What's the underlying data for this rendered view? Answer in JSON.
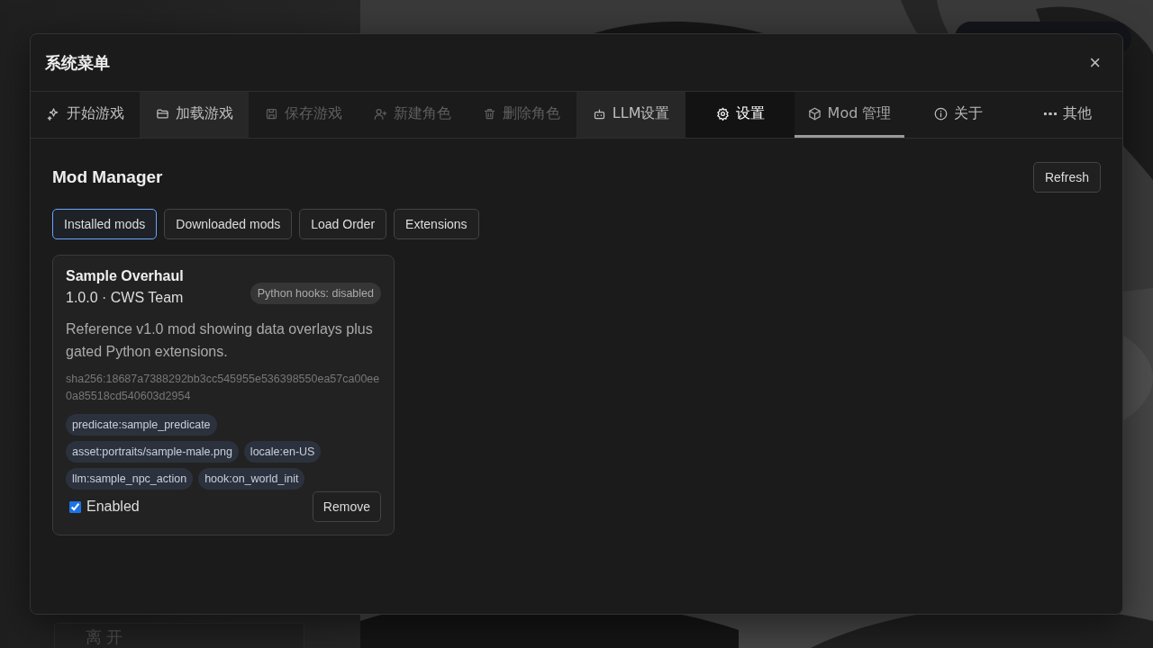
{
  "background": {
    "leave_button": "离 开"
  },
  "dialog": {
    "title": "系统菜单",
    "close": "×",
    "tabs": [
      {
        "label": "开始游戏",
        "disabled": false,
        "selected": false,
        "hovered": false,
        "focused": false
      },
      {
        "label": "加载游戏",
        "disabled": false,
        "selected": false,
        "hovered": true,
        "focused": false
      },
      {
        "label": "保存游戏",
        "disabled": true,
        "selected": false,
        "hovered": false,
        "focused": false
      },
      {
        "label": "新建角色",
        "disabled": true,
        "selected": false,
        "hovered": false,
        "focused": false
      },
      {
        "label": "删除角色",
        "disabled": true,
        "selected": false,
        "hovered": false,
        "focused": false
      },
      {
        "label": "LLM设置",
        "disabled": false,
        "selected": false,
        "hovered": true,
        "focused": false
      },
      {
        "label": "设置",
        "disabled": false,
        "selected": false,
        "hovered": false,
        "focused": true
      },
      {
        "label": "Mod 管理",
        "disabled": false,
        "selected": true,
        "hovered": false,
        "focused": false
      },
      {
        "label": "关于",
        "disabled": false,
        "selected": false,
        "hovered": false,
        "focused": false
      },
      {
        "label": "其他",
        "disabled": false,
        "selected": false,
        "hovered": false,
        "focused": false
      }
    ],
    "mod_manager": {
      "heading": "Mod Manager",
      "refresh": "Refresh",
      "subtabs": [
        {
          "label": "Installed mods",
          "selected": true
        },
        {
          "label": "Downloaded mods",
          "selected": false
        },
        {
          "label": "Load Order",
          "selected": false
        },
        {
          "label": "Extensions",
          "selected": false
        }
      ],
      "mods": [
        {
          "name": "Sample Overhaul",
          "meta": "1.0.0 · CWS Team",
          "badge": "Python hooks: disabled",
          "description": "Reference v1.0 mod showing data overlays plus gated Python extensions.",
          "hash": "sha256:18687a7388292bb3cc545955e536398550ea57ca00ee0a85518cd540603d2954",
          "tags": [
            "predicate:sample_predicate",
            "asset:portraits/sample-male.png",
            "locale:en-US",
            "llm:sample_npc_action",
            "hook:on_world_init"
          ],
          "enabled_label": "Enabled",
          "enabled": true,
          "remove": "Remove"
        }
      ]
    }
  }
}
